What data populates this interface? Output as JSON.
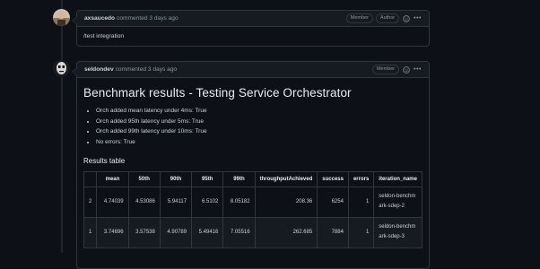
{
  "comments": [
    {
      "author": "axsaucedo",
      "meta": "commented 3 days ago",
      "badges": [
        "Member",
        "Author"
      ],
      "body": "/test integration"
    },
    {
      "author": "seldondev",
      "meta": "commented 3 days ago",
      "badges": [
        "Member"
      ],
      "title": "Benchmark results - Testing Service Orchestrator",
      "bullets": [
        "Orch added mean latency under 4ms: True",
        "Orch added 95th latency under 5ms: True",
        "Orch added 99th latency under 10ms: True",
        "No errors: True"
      ],
      "table_title": "Results table",
      "table": {
        "headers": [
          "",
          "mean",
          "50th",
          "90th",
          "95th",
          "99th",
          "throughputAchieved",
          "success",
          "errors",
          "iteration_name"
        ],
        "rows": [
          [
            "2",
            "4.74039",
            "4.53086",
            "5.94117",
            "6.5102",
            "8.05182",
            "208.36",
            "6254",
            "1",
            "seldon-benchmark-sdep-2"
          ],
          [
            "1",
            "3.74696",
            "3.57538",
            "4.90789",
            "5.49416",
            "7.05516",
            "262.685",
            "7884",
            "1",
            "seldon-benchmark-sdep-3"
          ]
        ]
      }
    }
  ],
  "icons": {
    "smile": "smiley-icon",
    "menu": "kebab-menu-icon"
  }
}
